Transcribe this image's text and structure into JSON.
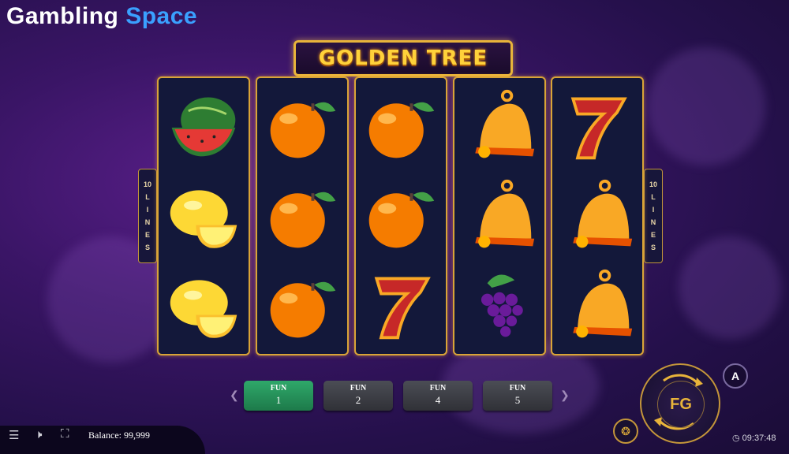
{
  "brand": {
    "word1": "Gambling",
    "word2": "Space"
  },
  "game": {
    "title": "GOLDEN TREE"
  },
  "side_lines": {
    "count": "10",
    "letters": [
      "L",
      "I",
      "N",
      "E",
      "S"
    ]
  },
  "reels": [
    [
      "watermelon",
      "lemon",
      "lemon"
    ],
    [
      "orange",
      "orange",
      "orange"
    ],
    [
      "orange",
      "orange",
      "seven"
    ],
    [
      "bell",
      "bell",
      "grapes"
    ],
    [
      "seven",
      "bell",
      "bell"
    ]
  ],
  "bets": [
    {
      "label": "FUN",
      "value": "1",
      "active": true
    },
    {
      "label": "FUN",
      "value": "2",
      "active": false
    },
    {
      "label": "FUN",
      "value": "4",
      "active": false
    },
    {
      "label": "FUN",
      "value": "5",
      "active": false
    }
  ],
  "footer": {
    "balance_label": "Balance:",
    "balance_value": "99,999",
    "time": "09:37:48"
  },
  "controls": {
    "auto_label": "A",
    "spin_logo": "FG"
  },
  "colors": {
    "gold": "#e8b43a",
    "active_bet": "#2fa86a",
    "brand_blue": "#3aa0ff"
  }
}
